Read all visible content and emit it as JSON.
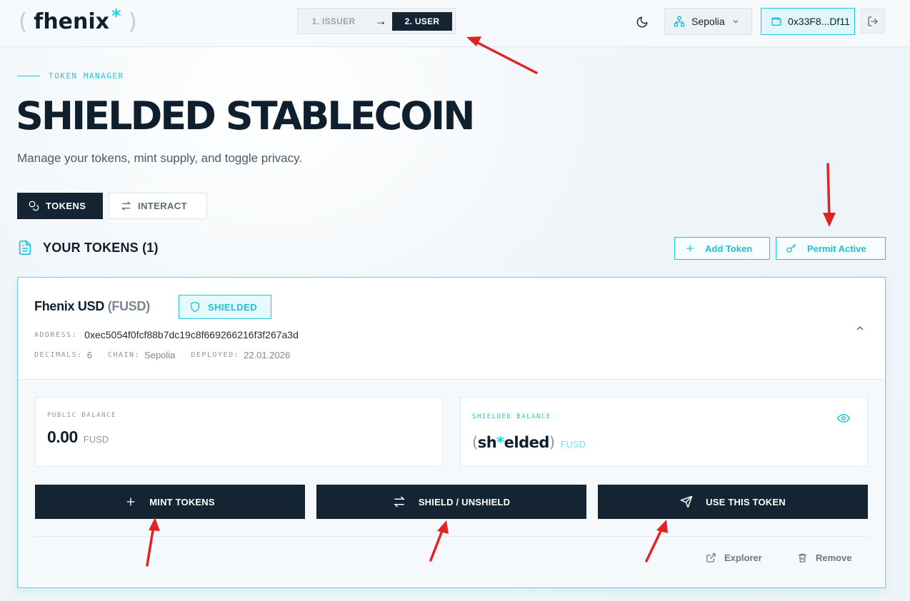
{
  "header": {
    "logo": {
      "open": "(",
      "word": "fhenix",
      "star": "*",
      "close": ")"
    },
    "stepper": {
      "step1": "1. ISSUER",
      "arrow": "→",
      "step2": "2. USER"
    },
    "theme_icon": "moon-icon",
    "network": {
      "label": "Sepolia",
      "icon": "network-icon"
    },
    "wallet": {
      "address": "0x33F8...Df11",
      "icon": "wallet-icon"
    },
    "logout_icon": "logout-icon"
  },
  "page": {
    "eyebrow": "TOKEN MANAGER",
    "title": "SHIELDED STABLECOIN",
    "subtitle": "Manage your tokens, mint supply, and toggle privacy."
  },
  "tabs": [
    {
      "label": "TOKENS",
      "icon": "coins-icon",
      "active": true
    },
    {
      "label": "INTERACT",
      "icon": "swap-icon",
      "active": false
    }
  ],
  "section": {
    "title": "YOUR TOKENS (1)",
    "add_token_label": "Add Token",
    "permit_label": "Permit Active"
  },
  "token": {
    "name": "Fhenix USD",
    "symbol": "(FUSD)",
    "badge": "SHIELDED",
    "address_label": "ADDRESS:",
    "address": "0xec5054f0fcf88b7dc19c8f669266216f3f267a3d",
    "decimals_label": "DECIMALS:",
    "decimals": "6",
    "chain_label": "CHAIN:",
    "chain": "Sepolia",
    "deployed_label": "DEPLOYED:",
    "deployed": "22.01.2026",
    "public_balance": {
      "label": "PUBLIC BALANCE",
      "value": "0.00",
      "unit": "FUSD"
    },
    "shielded_balance": {
      "label": "SHIELDED BALANCE",
      "open": "(",
      "pre": "sh",
      "star": "*",
      "post": "elded",
      "close": ")",
      "unit": "FUSD"
    },
    "actions": {
      "mint": "MINT TOKENS",
      "shield": "SHIELD / UNSHIELD",
      "use": "USE THIS TOKEN"
    },
    "explorer_label": "Explorer",
    "remove_label": "Remove"
  },
  "colors": {
    "accent": "#1ec8dc",
    "dark": "#152433",
    "annotation": "#e02424"
  }
}
